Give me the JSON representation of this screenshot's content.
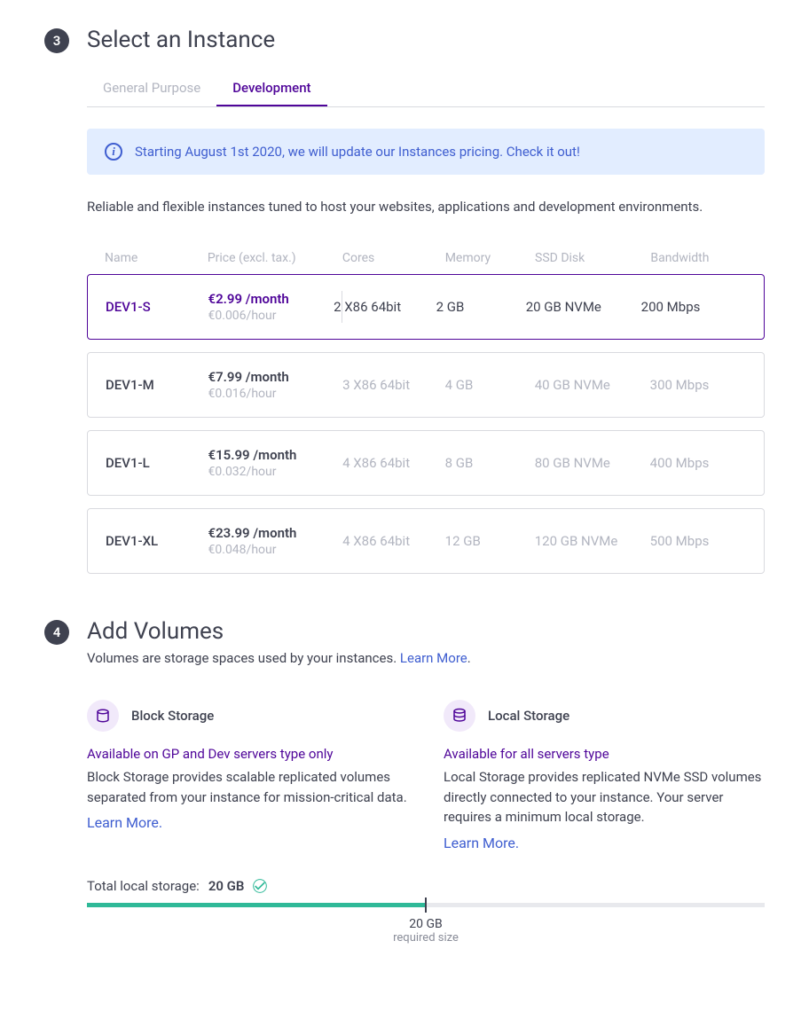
{
  "step3": {
    "number": "3",
    "title": "Select an Instance",
    "tabs": [
      {
        "label": "General Purpose",
        "active": false
      },
      {
        "label": "Development",
        "active": true
      }
    ],
    "banner": {
      "text": "Starting August 1st 2020, we will update our Instances pricing. ",
      "link": "Check it out!"
    },
    "description": "Reliable and flexible instances tuned to host your websites, applications and development environments.",
    "columns": {
      "name": "Name",
      "price": "Price (excl. tax.)",
      "cores": "Cores",
      "memory": "Memory",
      "disk": "SSD Disk",
      "bandwidth": "Bandwidth"
    },
    "instances": [
      {
        "name": "DEV1-S",
        "price_month": "€2.99 /month",
        "price_hour": "€0.006/hour",
        "cores": "2 X86 64bit",
        "memory": "2 GB",
        "disk": "20 GB NVMe",
        "bandwidth": "200 Mbps",
        "selected": true
      },
      {
        "name": "DEV1-M",
        "price_month": "€7.99 /month",
        "price_hour": "€0.016/hour",
        "cores": "3 X86 64bit",
        "memory": "4 GB",
        "disk": "40 GB NVMe",
        "bandwidth": "300 Mbps",
        "selected": false
      },
      {
        "name": "DEV1-L",
        "price_month": "€15.99 /month",
        "price_hour": "€0.032/hour",
        "cores": "4 X86 64bit",
        "memory": "8 GB",
        "disk": "80 GB NVMe",
        "bandwidth": "400 Mbps",
        "selected": false
      },
      {
        "name": "DEV1-XL",
        "price_month": "€23.99 /month",
        "price_hour": "€0.048/hour",
        "cores": "4 X86 64bit",
        "memory": "12 GB",
        "disk": "120 GB NVMe",
        "bandwidth": "500 Mbps",
        "selected": false
      }
    ]
  },
  "step4": {
    "number": "4",
    "title": "Add Volumes",
    "subtitle": "Volumes are storage spaces used by your instances. ",
    "learn_more": "Learn More",
    "block": {
      "title": "Block Storage",
      "note": "Available on GP and Dev servers type only",
      "desc": "Block Storage provides scalable replicated volumes separated from your instance for mission-critical data.",
      "link": "Learn More."
    },
    "local": {
      "title": "Local Storage",
      "note": "Available for all servers type",
      "desc": "Local Storage provides replicated NVMe SSD volumes directly connected to your instance. Your server requires a minimum local storage.",
      "link": "Learn More."
    },
    "storage": {
      "label": "Total local storage: ",
      "value": "20 GB",
      "required_value": "20 GB",
      "required_label": "required size"
    }
  }
}
